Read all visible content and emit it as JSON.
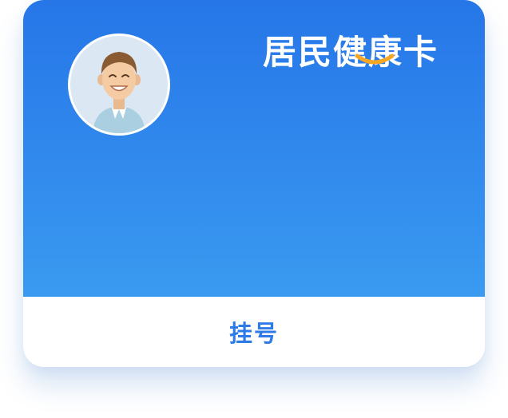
{
  "card": {
    "title": "居民健康卡",
    "action_label": "挂号"
  },
  "colors": {
    "header_gradient_top": "#2676e8",
    "header_gradient_bottom": "#3a9af0",
    "accent": "#f5a623",
    "action_text": "#2e7ae6"
  },
  "icons": {
    "avatar": "user-avatar-icon",
    "title_mark": "smile-curve-icon"
  }
}
